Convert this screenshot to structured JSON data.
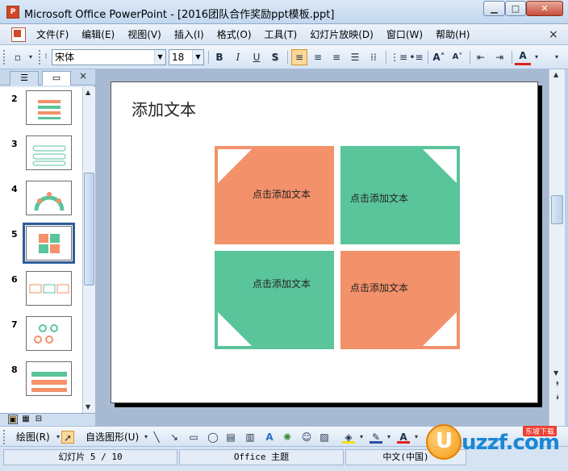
{
  "app": {
    "title": "Microsoft Office PowerPoint - [2016团队合作奖励ppt模板.ppt]",
    "minimize": "▁",
    "maximize": "□",
    "close": "✕"
  },
  "menu": {
    "items": [
      "文件(F)",
      "编辑(E)",
      "视图(V)",
      "插入(I)",
      "格式(O)",
      "工具(T)",
      "幻灯片放映(D)",
      "窗口(W)",
      "帮助(H)"
    ],
    "close": "×"
  },
  "format_toolbar": {
    "font_name": "宋体",
    "font_size": "18",
    "bold": "B",
    "italic": "I",
    "underline": "U",
    "shadow": "S",
    "font_color_label": "A"
  },
  "slides_pane": {
    "close": "×",
    "thumbnails": [
      {
        "number": "2"
      },
      {
        "number": "3"
      },
      {
        "number": "4"
      },
      {
        "number": "5",
        "selected": true
      },
      {
        "number": "6"
      },
      {
        "number": "7"
      },
      {
        "number": "8"
      }
    ]
  },
  "slide": {
    "title": "添加文本",
    "quadrants": [
      {
        "text": "点击添加文本",
        "color": "#f2916a"
      },
      {
        "text": "点击添加文本",
        "color": "#5ac49b"
      },
      {
        "text": "点击添加文本",
        "color": "#5ac49b"
      },
      {
        "text": "点击添加文本",
        "color": "#f2916a"
      }
    ]
  },
  "drawing_toolbar": {
    "draw_label": "绘图(R)",
    "autoshapes_label": "自选图形(U)"
  },
  "status": {
    "slide_info": "幻灯片 5 / 10",
    "theme": "Office 主题",
    "language": "中文(中国)"
  },
  "watermark": {
    "text": "uzzf.com",
    "tag": "东坡下载"
  },
  "colors": {
    "coral": "#f2916a",
    "green": "#5ac49b",
    "selection_border": "#2f5d9b"
  }
}
